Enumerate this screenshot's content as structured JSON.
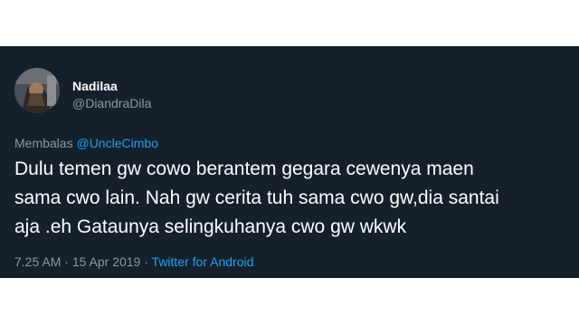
{
  "author": {
    "display_name": "Nadilaa",
    "handle": "@DiandraDila"
  },
  "reply": {
    "prefix": "Membalas",
    "mention": "@UncleCimbo"
  },
  "tweet": {
    "lines": [
      "Dulu temen gw cowo berantem gegara cewenya maen",
      "sama cwo lain. Nah gw cerita tuh sama cwo gw,dia santai",
      "aja .eh  Gataunya selingkuhanya cwo gw wkwk"
    ]
  },
  "meta": {
    "time": "7.25 AM",
    "sep1": " · ",
    "date": "15 Apr 2019",
    "sep2": " · ",
    "source": "Twitter for Android"
  },
  "colors": {
    "background": "#15202b",
    "text": "#ffffff",
    "muted": "#8899a6",
    "link": "#1da1f2"
  }
}
